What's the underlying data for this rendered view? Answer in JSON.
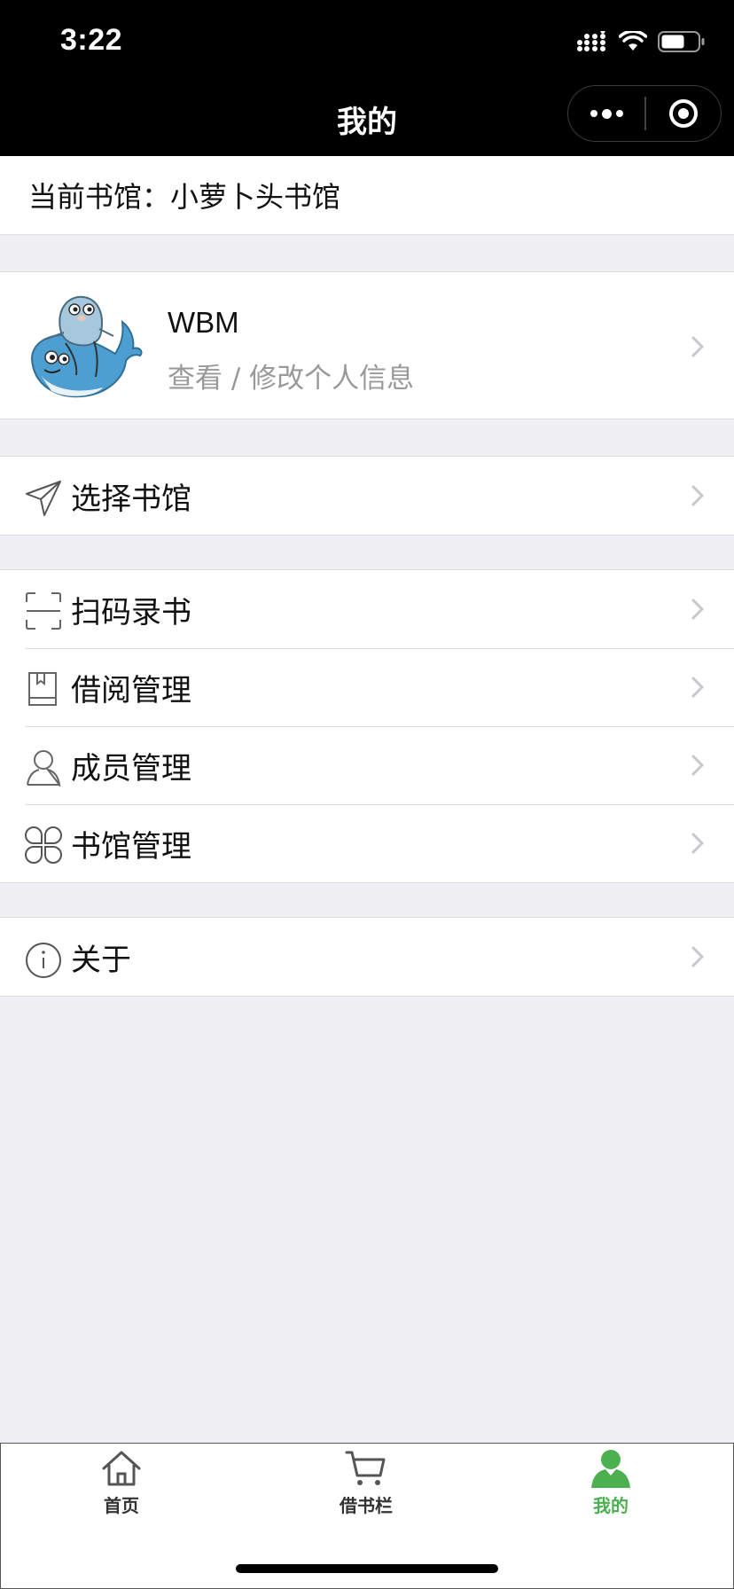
{
  "status_bar": {
    "time": "3:22"
  },
  "nav": {
    "title": "我的"
  },
  "library": {
    "current_label": "当前书馆：小萝卜头书馆"
  },
  "profile": {
    "name": "WBM",
    "subtitle": "查看 / 修改个人信息"
  },
  "menu": {
    "select_library": "选择书馆",
    "scan": "扫码录书",
    "borrow_manage": "借阅管理",
    "member_manage": "成员管理",
    "library_manage": "书馆管理",
    "about": "关于"
  },
  "tabs": [
    {
      "label": "首页",
      "icon": "home-icon"
    },
    {
      "label": "借书栏",
      "icon": "cart-icon"
    },
    {
      "label": "我的",
      "icon": "user-icon"
    }
  ],
  "colors": {
    "active_tab": "#4caf50",
    "nav_bg": "#000000",
    "page_bg": "#efeff4"
  }
}
